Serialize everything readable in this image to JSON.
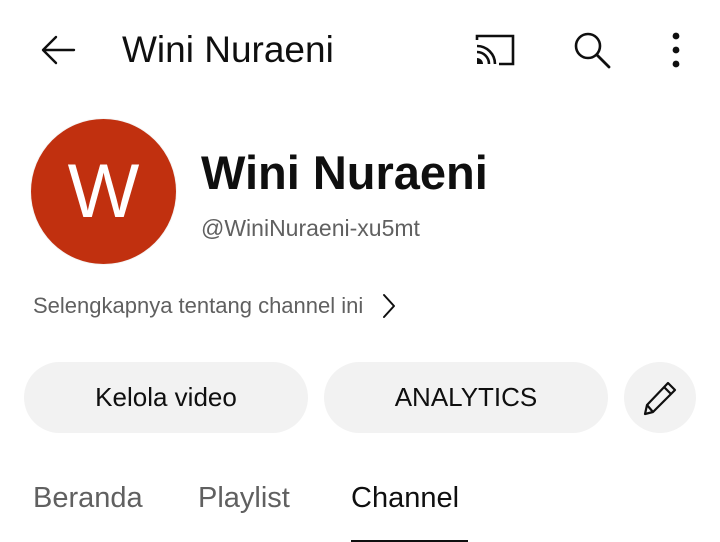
{
  "topbar": {
    "title": "Wini Nuraeni",
    "back_icon": "arrow-left-icon",
    "cast_icon": "cast-icon",
    "search_icon": "search-icon",
    "more_icon": "more-vertical-icon"
  },
  "channel": {
    "avatar_letter": "W",
    "avatar_color": "#c1300f",
    "name": "Wini Nuraeni",
    "handle": "@WiniNuraeni-xu5mt",
    "more_about": "Selengkapnya tentang channel ini",
    "more_about_icon": "chevron-right-icon"
  },
  "actions": {
    "manage_videos": "Kelola video",
    "analytics": "ANALYTICS",
    "edit_icon": "pencil-icon"
  },
  "tabs": [
    {
      "label": "Beranda",
      "selected": false
    },
    {
      "label": "Playlist",
      "selected": false
    },
    {
      "label": "Channel",
      "selected": true
    }
  ]
}
